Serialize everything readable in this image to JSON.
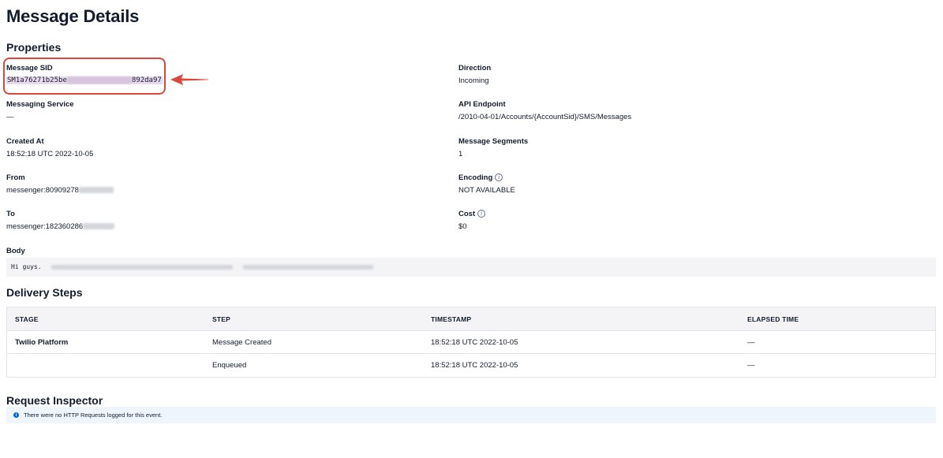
{
  "page": {
    "title": "Message Details"
  },
  "properties": {
    "title": "Properties",
    "left": [
      {
        "label": "Message SID",
        "value_start": "SM1a76271b25be",
        "value_end": "892da97"
      },
      {
        "label": "Messaging Service",
        "value": "—"
      },
      {
        "label": "Created At",
        "value": "18:52:18 UTC 2022-10-05"
      },
      {
        "label": "From",
        "value": "messenger:80909278"
      },
      {
        "label": "To",
        "value": "messenger:182360286"
      }
    ],
    "right": [
      {
        "label": "Direction",
        "value": "Incoming"
      },
      {
        "label": "API Endpoint",
        "value": "/2010-04-01/Accounts/{AccountSid}/SMS/Messages"
      },
      {
        "label": "Message Segments",
        "value": "1"
      },
      {
        "label": "Encoding",
        "value": "NOT AVAILABLE",
        "info_icon": "info-icon"
      },
      {
        "label": "Cost",
        "value": "$0",
        "info_icon": "info-icon"
      }
    ],
    "body": {
      "label": "Body",
      "value": "Hi guys."
    }
  },
  "delivery": {
    "title": "Delivery Steps",
    "columns": [
      "STAGE",
      "STEP",
      "TIMESTAMP",
      "ELAPSED TIME"
    ],
    "rows": [
      {
        "stage": "Twilio Platform",
        "step": "Message Created",
        "timestamp": "18:52:18 UTC 2022-10-05",
        "elapsed": "—"
      },
      {
        "stage": "",
        "step": "Enqueued",
        "timestamp": "18:52:18 UTC 2022-10-05",
        "elapsed": "—"
      }
    ]
  },
  "inspector": {
    "title": "Request Inspector",
    "notice": "There were no HTTP Requests logged for this event.",
    "notice_icon": "info-icon"
  },
  "colors": {
    "highlight": "#d9483b",
    "text": "#121c2d",
    "notice_bg": "#eef5fc",
    "info_blue": "#0263e0"
  }
}
